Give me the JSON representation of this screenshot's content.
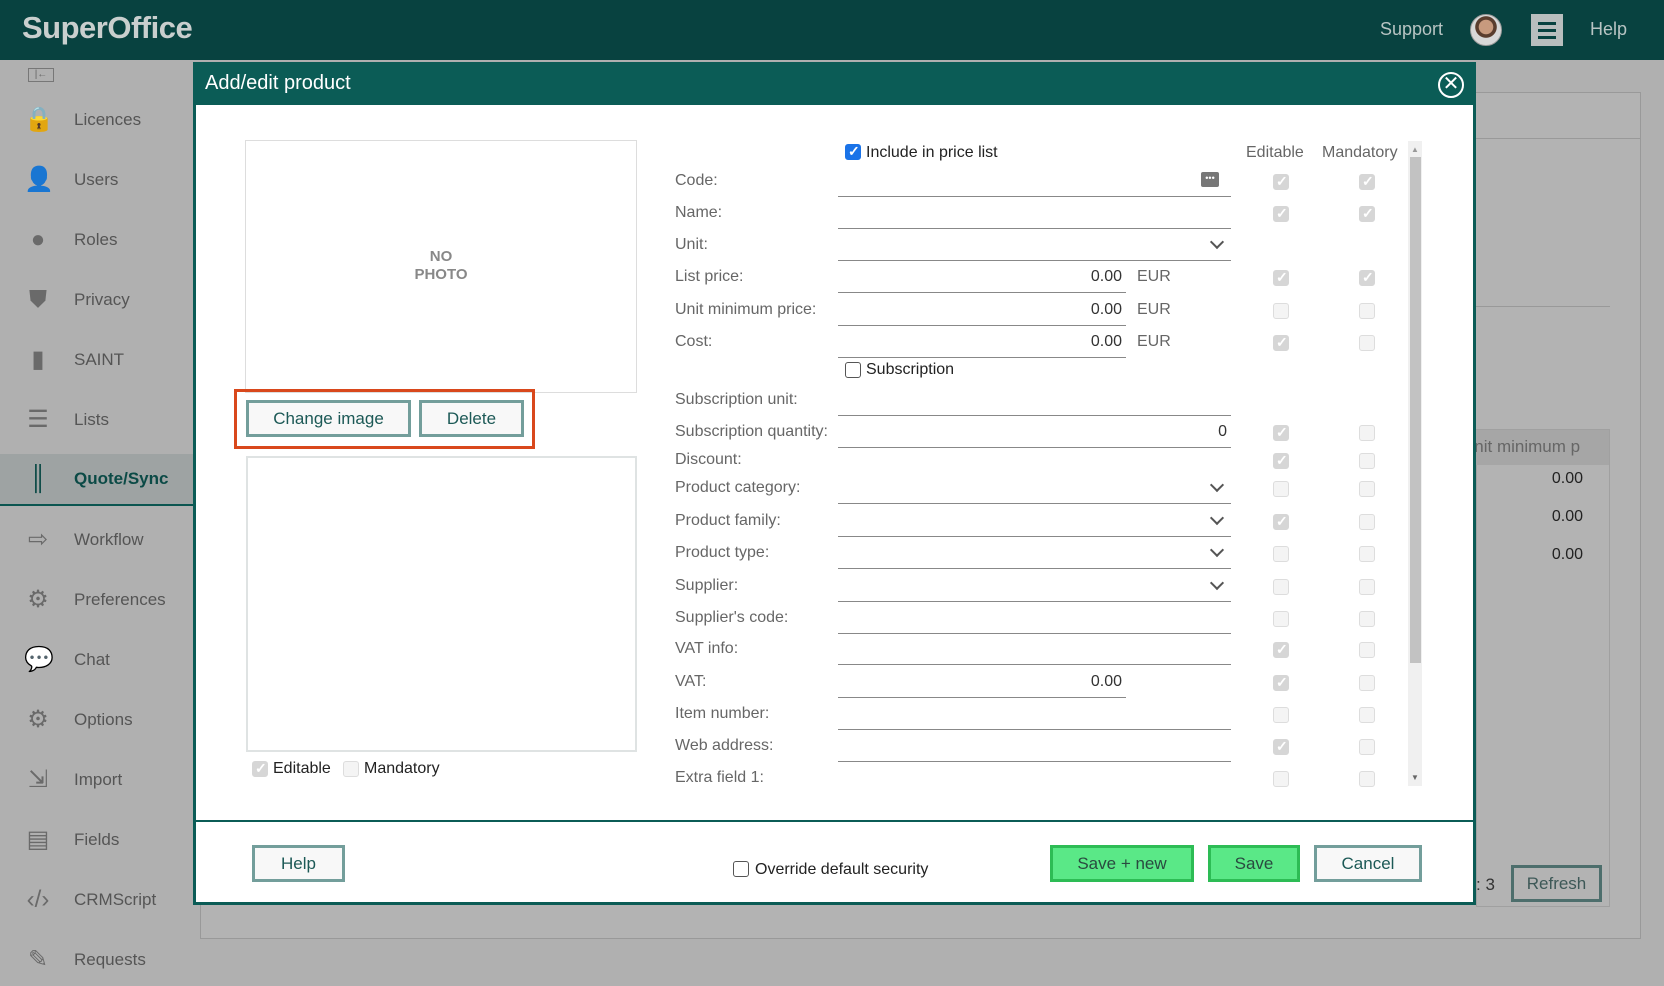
{
  "app": {
    "logo": "SuperOffice",
    "support": "Support",
    "help": "Help"
  },
  "sidebar": {
    "items": [
      {
        "label": "Licences",
        "icon": "lock-icon",
        "glyph": "🔒"
      },
      {
        "label": "Users",
        "icon": "user-icon",
        "glyph": "👤"
      },
      {
        "label": "Roles",
        "icon": "roles-toggle-icon",
        "glyph": "●"
      },
      {
        "label": "Privacy",
        "icon": "shield-icon",
        "glyph": "⛊"
      },
      {
        "label": "SAINT",
        "icon": "bar-chart-icon",
        "glyph": "▮"
      },
      {
        "label": "Lists",
        "icon": "list-icon",
        "glyph": "☰"
      },
      {
        "label": "Quote/Sync",
        "icon": "barcode-icon",
        "glyph": "║",
        "active": true
      },
      {
        "label": "Workflow",
        "icon": "workflow-icon",
        "glyph": "⇨"
      },
      {
        "label": "Preferences",
        "icon": "gear-icon",
        "glyph": "⚙"
      },
      {
        "label": "Chat",
        "icon": "chat-icon",
        "glyph": "💬"
      },
      {
        "label": "Options",
        "icon": "gear-icon",
        "glyph": "⚙"
      },
      {
        "label": "Import",
        "icon": "import-icon",
        "glyph": "⇲"
      },
      {
        "label": "Fields",
        "icon": "fields-icon",
        "glyph": "▤"
      },
      {
        "label": "CRMScript",
        "icon": "code-icon",
        "glyph": "‹/›"
      },
      {
        "label": "Requests",
        "icon": "requests-icon",
        "glyph": "✎"
      }
    ]
  },
  "background": {
    "column_header": "Unit minimum p",
    "values": [
      "0.00",
      "0.00",
      "0.00"
    ],
    "count": ": 3",
    "refresh": "Refresh"
  },
  "dialog": {
    "title": "Add/edit product",
    "no_photo": "NO\nPHOTO",
    "change_image": "Change image",
    "delete": "Delete",
    "desc_editable": "Editable",
    "desc_mandatory": "Mandatory",
    "include_in_price_list": "Include in price list",
    "include_checked": true,
    "col_editable": "Editable",
    "col_mandatory": "Mandatory",
    "fields": [
      {
        "label": "Code:",
        "type": "text",
        "value": "",
        "editable": true,
        "mandatory": true,
        "lookup": true
      },
      {
        "label": "Name:",
        "type": "text",
        "value": "",
        "editable": true,
        "mandatory": true
      },
      {
        "label": "Unit:",
        "type": "select",
        "value": ""
      },
      {
        "label": "List price:",
        "type": "money",
        "value": "0.00",
        "currency": "EUR",
        "editable": true,
        "mandatory": true
      },
      {
        "label": "Unit minimum price:",
        "type": "money",
        "value": "0.00",
        "currency": "EUR",
        "editable": false,
        "mandatory": false
      },
      {
        "label": "Cost:",
        "type": "money",
        "value": "0.00",
        "currency": "EUR",
        "editable": true,
        "mandatory": false
      },
      {
        "label": "Subscription",
        "type": "checkbox",
        "checked": false
      },
      {
        "label": "Subscription unit:",
        "type": "text",
        "value": ""
      },
      {
        "label": "Subscription quantity:",
        "type": "text",
        "value": "0",
        "editable": true,
        "mandatory": false
      },
      {
        "label": "Discount:",
        "type": "none",
        "editable": true,
        "mandatory": false
      },
      {
        "label": "Product category:",
        "type": "select",
        "value": "",
        "editable": false,
        "mandatory": false
      },
      {
        "label": "Product family:",
        "type": "select",
        "value": "",
        "editable": true,
        "mandatory": false
      },
      {
        "label": "Product type:",
        "type": "select",
        "value": "",
        "editable": false,
        "mandatory": false
      },
      {
        "label": "Supplier:",
        "type": "select",
        "value": "",
        "editable": false,
        "mandatory": false
      },
      {
        "label": "Supplier's code:",
        "type": "text",
        "value": "",
        "editable": false,
        "mandatory": false
      },
      {
        "label": "VAT info:",
        "type": "text",
        "value": "",
        "editable": true,
        "mandatory": false
      },
      {
        "label": "VAT:",
        "type": "short",
        "value": "0.00",
        "editable": true,
        "mandatory": false
      },
      {
        "label": "Item number:",
        "type": "text",
        "value": "",
        "editable": false,
        "mandatory": false
      },
      {
        "label": "Web address:",
        "type": "text",
        "value": "",
        "editable": true,
        "mandatory": false
      },
      {
        "label": "Extra field 1:",
        "type": "none",
        "editable": false,
        "mandatory": false
      }
    ],
    "footer": {
      "help": "Help",
      "override": "Override default security",
      "save_new": "Save + new",
      "save": "Save",
      "cancel": "Cancel"
    }
  },
  "colors": {
    "header": "#084240",
    "dialog_accent": "#0b5c56",
    "save": "#5ae887",
    "highlight": "#d9481c"
  }
}
